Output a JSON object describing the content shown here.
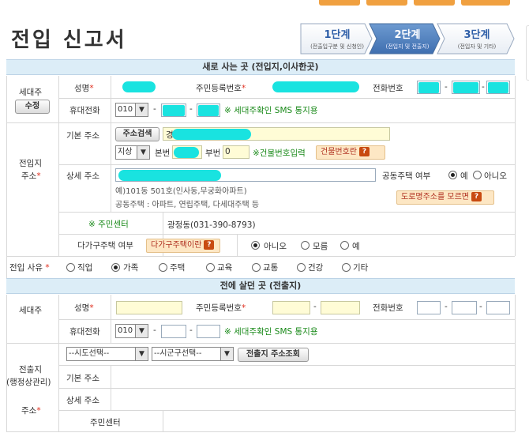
{
  "title": "전입 신고서",
  "steps": [
    {
      "num": "1단계",
      "sub": "(전출입구분 및 신청인)"
    },
    {
      "num": "2단계",
      "sub": "(전입지 및 전출지)"
    },
    {
      "num": "3단계",
      "sub": "(전입자 및 기타)"
    }
  ],
  "new_section": {
    "header": "새로 사는 곳 (전입지,이사한곳)",
    "householder_label": "세대주",
    "edit_button": "수정",
    "name_label": "성명",
    "rrn_label": "주민등록번호",
    "phone_label": "전화번호",
    "mobile_label": "휴대전화",
    "mobile_prefix": "010",
    "sms_note": "※ 세대주확인 SMS 통지용",
    "address_group_label": "전입지",
    "address_group_label2": "주소",
    "basic_address_label": "기본 주소",
    "search_button": "주소검색",
    "address_value_prefix": "경",
    "land_type": "지상",
    "main_number_label": "본번",
    "sub_number_label": "부번",
    "sub_number_value": "0",
    "building_input_note": "※건물번호입력",
    "building_info_button": "건물번호란",
    "detail_address_label": "상세 주소",
    "example_line1": "예)101동 501호(인사동,무궁화아파트)",
    "example_line2": "공동주택 : 아파트, 연립주택, 다세대주택 등",
    "shared_housing_label": "공동주택 여부",
    "shared_yes": "예",
    "shared_no": "아니오",
    "road_name_button": "도로명주소를 모르면",
    "center_label": "※ 주민센터",
    "center_value": "광정동(031-390-8793)",
    "multi_housing_label": "다가구주택 여부",
    "multi_housing_button": "다가구주택이란",
    "multi_options": [
      "아니오",
      "모름",
      "예"
    ]
  },
  "reason": {
    "label": "전입 사유",
    "options": [
      "직업",
      "가족",
      "주택",
      "교육",
      "교통",
      "건강",
      "기타"
    ]
  },
  "old_section": {
    "header": "전에 살던 곳 (전출지)",
    "householder_label": "세대주",
    "name_label": "성명",
    "rrn_label": "주민등록번호",
    "phone_label": "전화번호",
    "mobile_label": "휴대전화",
    "mobile_prefix": "010",
    "sms_note": "※ 세대주확인 SMS 통지용",
    "address_group_label": "전출지",
    "address_group_label2": "(행정상관리)",
    "address_group_label3": "주소",
    "sido_select": "--시도선택--",
    "sigungu_select": "--시군구선택--",
    "lookup_button": "전출지 주소조회",
    "basic_address_label": "기본 주소",
    "detail_address_label": "상세 주소",
    "center_label": "주민센터"
  },
  "separators": {
    "dash": "-"
  },
  "icons": {
    "dropdown": "▼",
    "help": "?"
  },
  "colors": {
    "accent": "#2f5fa8",
    "header_bg": "#dcedf7",
    "redacted": "#19e3e0",
    "highlight_input": "#fffcd6"
  }
}
